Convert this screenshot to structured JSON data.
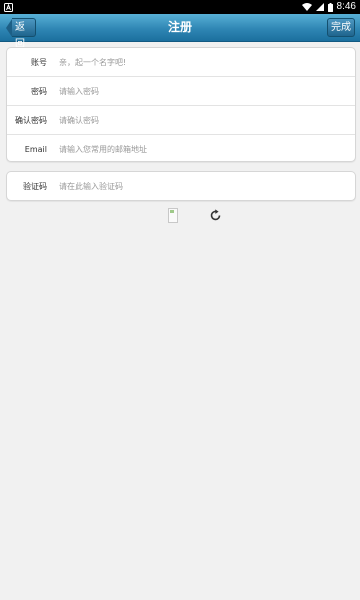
{
  "status_bar": {
    "left_icon": "android-a-icon",
    "time": "8:46",
    "icons": [
      "wifi-icon",
      "signal-icon",
      "battery-icon"
    ]
  },
  "header": {
    "title": "注册",
    "back_label": "返回",
    "done_label": "完成",
    "color": "#2f86b4"
  },
  "form": {
    "fields": [
      {
        "label": "账号",
        "placeholder": "亲，起一个名字吧!",
        "value": ""
      },
      {
        "label": "密码",
        "placeholder": "请输入密码",
        "value": ""
      },
      {
        "label": "确认密码",
        "placeholder": "请确认密码",
        "value": ""
      },
      {
        "label": "Email",
        "placeholder": "请输入您常用的邮箱地址",
        "value": ""
      }
    ],
    "captcha": {
      "label": "验证码",
      "placeholder": "请在此输入验证码",
      "value": ""
    }
  },
  "captcha_area": {
    "image_icon": "broken-image-icon",
    "refresh_icon": "refresh-icon"
  }
}
